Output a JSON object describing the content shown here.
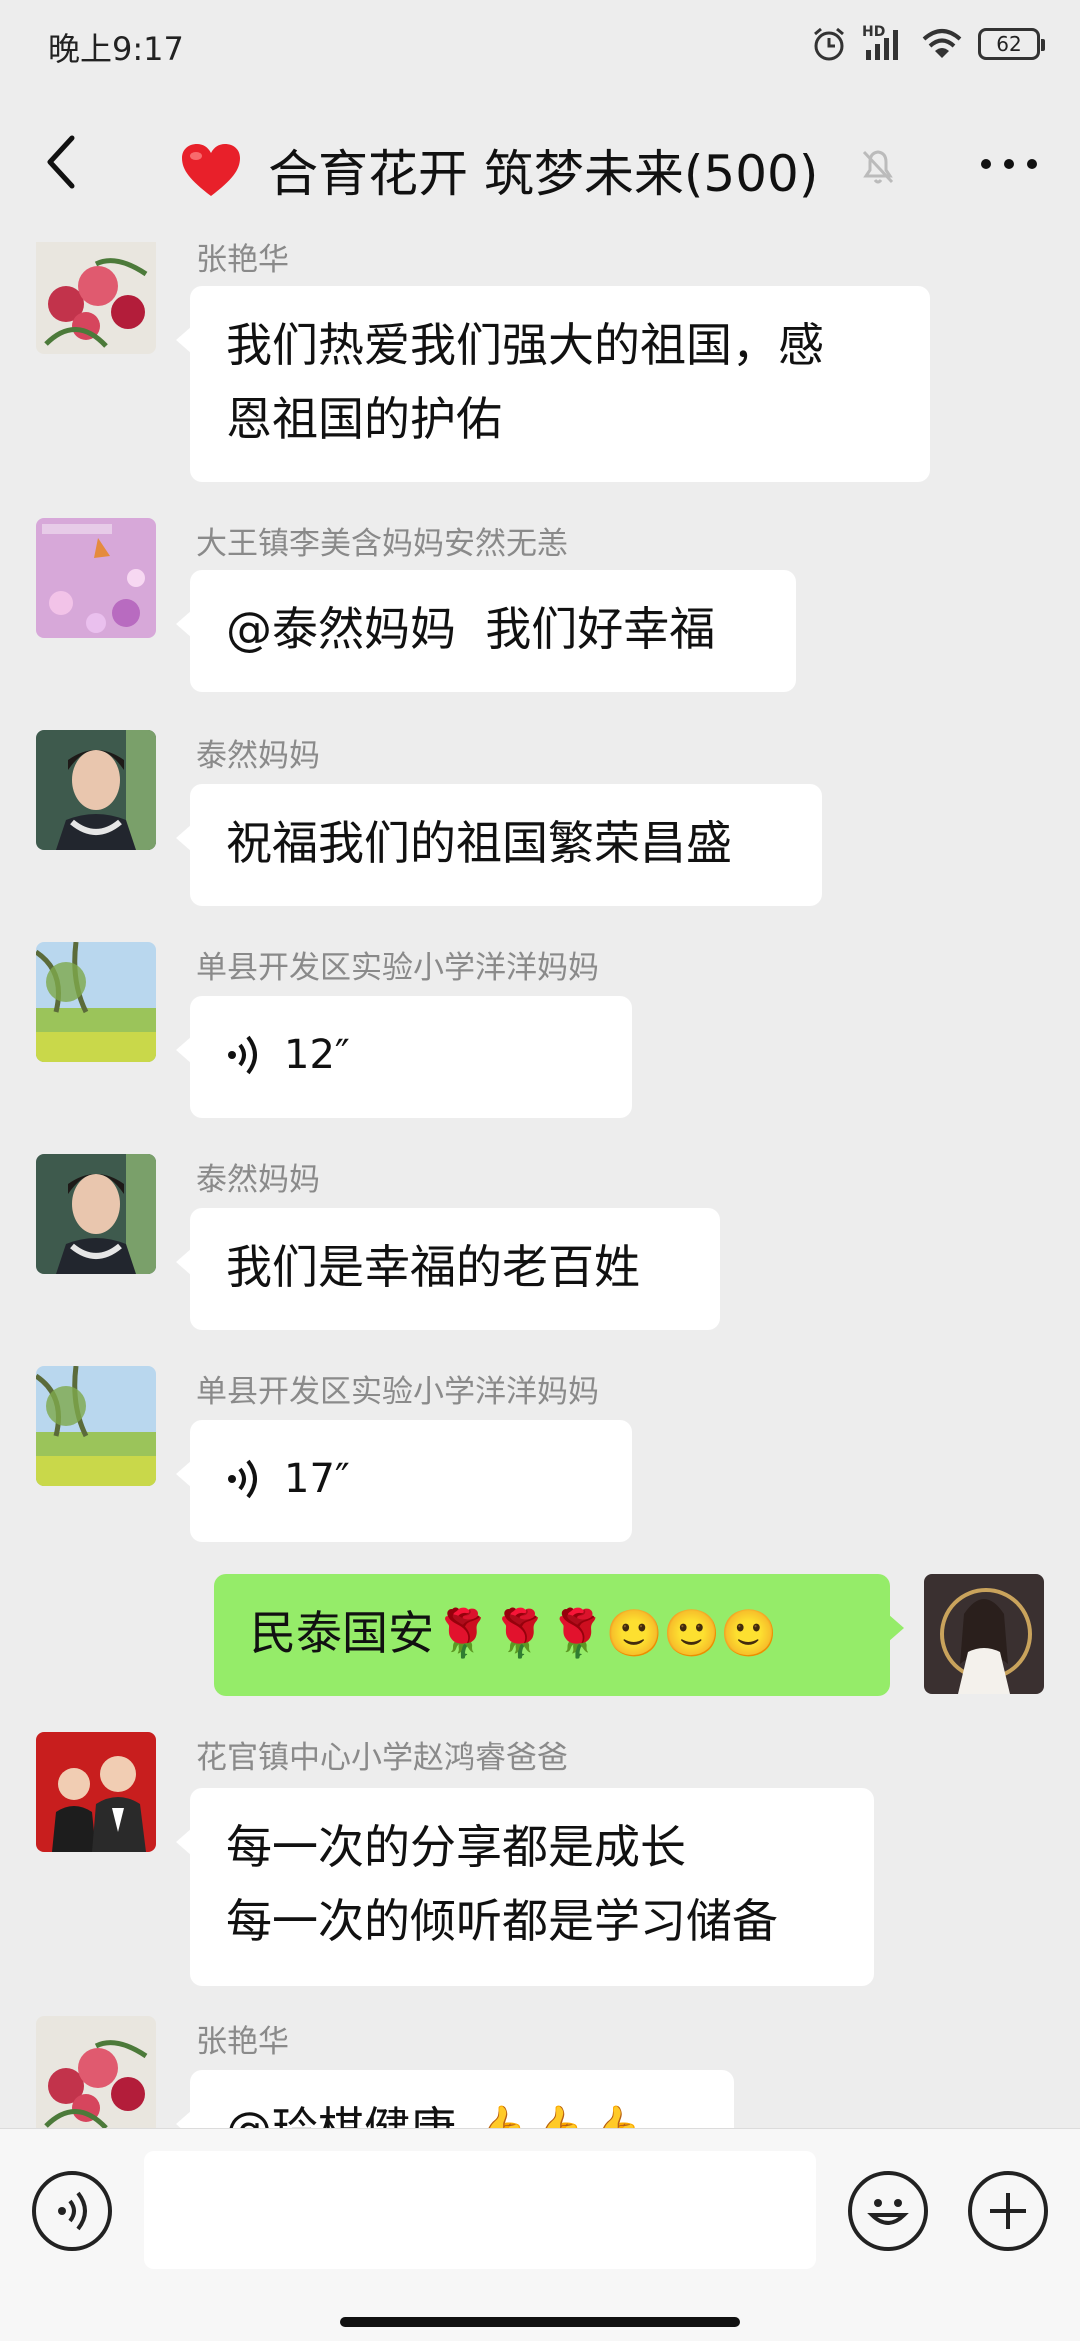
{
  "status": {
    "time": "晚上9:17",
    "hd_label": "HD",
    "battery": "62"
  },
  "header": {
    "title": "合育花开 筑梦未来(500)",
    "heart_icon": "red-heart-icon",
    "mute_icon": "bell-muted-icon"
  },
  "messages": [
    {
      "sender": "张艳华",
      "text_lines": [
        "我们热爱我们强大的祖国，感",
        "恩祖国的护佑"
      ]
    },
    {
      "sender": "大王镇李美含妈妈安然无恙",
      "text": "@泰然妈妈  我们好幸福"
    },
    {
      "sender": "泰然妈妈",
      "text": "祝福我们的祖国繁荣昌盛"
    },
    {
      "sender": "单县开发区实验小学洋洋妈妈",
      "voice_duration": "12″"
    },
    {
      "sender": "泰然妈妈",
      "text": "我们是幸福的老百姓"
    },
    {
      "sender": "单县开发区实验小学洋洋妈妈",
      "voice_duration": "17″"
    },
    {
      "self": true,
      "text": "民泰国安🌹🌹🌹🙂🙂🙂"
    },
    {
      "sender": "花官镇中心小学赵鸿睿爸爸",
      "text_lines": [
        "每一次的分享都是成长",
        "每一次的倾听都是学习储备"
      ]
    },
    {
      "sender": "张艳华",
      "text": "@玲棋健康 👍👍👍"
    }
  ],
  "icons": [
    "back-arrow-icon",
    "more-dots-icon",
    "voice-input-icon",
    "emoji-icon",
    "plus-icon",
    "voice-wave-icon"
  ],
  "colors": {
    "background": "#ededed",
    "bubble_self": "#95ec69",
    "bubble_other": "#ffffff"
  }
}
